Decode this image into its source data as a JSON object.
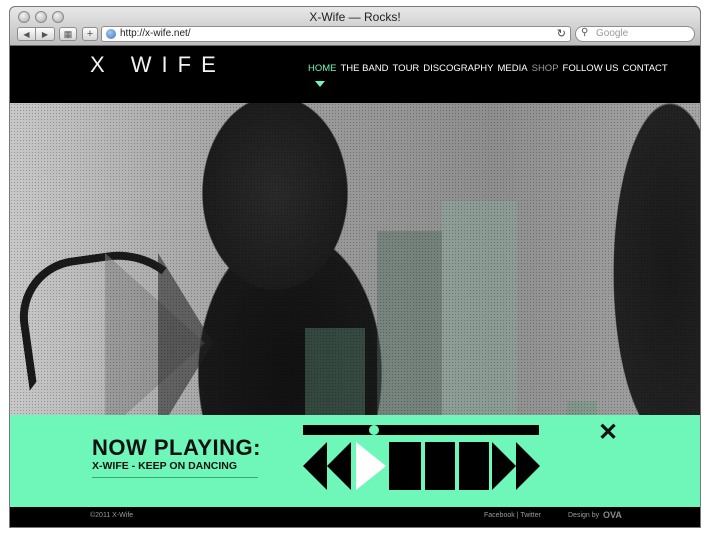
{
  "browser": {
    "title": "X-Wife — Rocks!",
    "url": "http://x-wife.net/",
    "search_placeholder": "Google"
  },
  "site": {
    "logo": "X WIFE",
    "nav": [
      {
        "label": "HOME",
        "state": "active"
      },
      {
        "label": "THE BAND",
        "state": "normal"
      },
      {
        "label": "TOUR",
        "state": "normal"
      },
      {
        "label": "DISCOGRAPHY",
        "state": "normal"
      },
      {
        "label": "MEDIA",
        "state": "normal"
      },
      {
        "label": "SHOP",
        "state": "dim"
      },
      {
        "label": "FOLLOW US",
        "state": "normal"
      },
      {
        "label": "CONTACT",
        "state": "normal"
      }
    ]
  },
  "player": {
    "heading": "NOW PLAYING:",
    "track": "X-WIFE - KEEP ON DANCING",
    "close_symbol": "✕",
    "progress_fraction": 0.3
  },
  "footer": {
    "copyright": "©2011 X-Wife",
    "social": "Facebook | Twitter",
    "design_credit": "Design by",
    "designer_logo": "OVA"
  },
  "colors": {
    "accent": "#6ff7b9",
    "background": "#000000"
  },
  "icons": {
    "rewind": "rewind-icon",
    "play": "play-icon",
    "pause": "pause-icon",
    "fast_forward": "fast-forward-icon",
    "close": "close-icon"
  }
}
